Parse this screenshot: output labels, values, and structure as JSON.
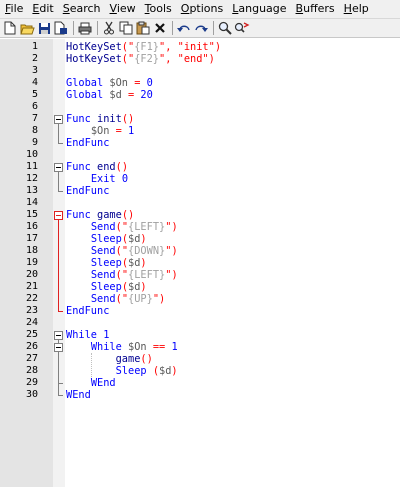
{
  "menu": [
    {
      "label": "File",
      "acc": "F",
      "rest": "ile"
    },
    {
      "label": "Edit",
      "acc": "E",
      "rest": "dit"
    },
    {
      "label": "Search",
      "acc": "S",
      "rest": "earch"
    },
    {
      "label": "View",
      "acc": "V",
      "rest": "iew"
    },
    {
      "label": "Tools",
      "acc": "T",
      "rest": "ools"
    },
    {
      "label": "Options",
      "acc": "O",
      "rest": "ptions"
    },
    {
      "label": "Language",
      "acc": "L",
      "rest": "anguage"
    },
    {
      "label": "Buffers",
      "acc": "B",
      "rest": "uffers"
    },
    {
      "label": "Help",
      "acc": "H",
      "rest": "elp"
    }
  ],
  "toolbar": [
    "new-file-icon",
    "open-folder-icon",
    "save-icon",
    "save-as-icon",
    "print-icon",
    "cut-icon",
    "copy-icon",
    "paste-icon",
    "delete-icon",
    "undo-icon",
    "redo-icon",
    "find-icon",
    "replace-icon"
  ],
  "lines": [
    {
      "n": "1",
      "tokens": [
        [
          "f",
          "HotKeySet"
        ],
        [
          "p",
          "("
        ],
        [
          "s",
          "\""
        ],
        [
          "g",
          "{F1}"
        ],
        [
          "s",
          "\""
        ],
        [
          "p",
          ","
        ],
        [
          "x",
          " "
        ],
        [
          "s",
          "\"init\""
        ],
        [
          "p",
          ")"
        ]
      ]
    },
    {
      "n": "2",
      "tokens": [
        [
          "f",
          "HotKeySet"
        ],
        [
          "p",
          "("
        ],
        [
          "s",
          "\""
        ],
        [
          "g",
          "{F2}"
        ],
        [
          "s",
          "\""
        ],
        [
          "p",
          ","
        ],
        [
          "x",
          " "
        ],
        [
          "s",
          "\"end\""
        ],
        [
          "p",
          ")"
        ]
      ]
    },
    {
      "n": "3",
      "tokens": []
    },
    {
      "n": "4",
      "tokens": [
        [
          "b",
          "Global"
        ],
        [
          "x",
          " "
        ],
        [
          "v",
          "$On"
        ],
        [
          "x",
          " "
        ],
        [
          "p",
          "="
        ],
        [
          "x",
          " "
        ],
        [
          "b",
          "0"
        ]
      ]
    },
    {
      "n": "5",
      "tokens": [
        [
          "b",
          "Global"
        ],
        [
          "x",
          " "
        ],
        [
          "v",
          "$d"
        ],
        [
          "x",
          " "
        ],
        [
          "p",
          "="
        ],
        [
          "x",
          " "
        ],
        [
          "b",
          "20"
        ]
      ]
    },
    {
      "n": "6",
      "tokens": []
    },
    {
      "n": "7",
      "tokens": [
        [
          "b",
          "Func"
        ],
        [
          "x",
          " "
        ],
        [
          "f",
          "init"
        ],
        [
          "p",
          "()"
        ]
      ]
    },
    {
      "n": "8",
      "tokens": [
        [
          "x",
          "    "
        ],
        [
          "v",
          "$On"
        ],
        [
          "x",
          " "
        ],
        [
          "p",
          "="
        ],
        [
          "x",
          " "
        ],
        [
          "b",
          "1"
        ]
      ]
    },
    {
      "n": "9",
      "tokens": [
        [
          "b",
          "EndFunc"
        ]
      ]
    },
    {
      "n": "10",
      "tokens": []
    },
    {
      "n": "11",
      "tokens": [
        [
          "b",
          "Func"
        ],
        [
          "x",
          " "
        ],
        [
          "f",
          "end"
        ],
        [
          "p",
          "()"
        ]
      ]
    },
    {
      "n": "12",
      "tokens": [
        [
          "x",
          "    "
        ],
        [
          "b",
          "Exit"
        ],
        [
          "x",
          " "
        ],
        [
          "b",
          "0"
        ]
      ]
    },
    {
      "n": "13",
      "tokens": [
        [
          "b",
          "EndFunc"
        ]
      ]
    },
    {
      "n": "14",
      "tokens": []
    },
    {
      "n": "15",
      "tokens": [
        [
          "b",
          "Func"
        ],
        [
          "x",
          " "
        ],
        [
          "f",
          "game"
        ],
        [
          "p",
          "()"
        ]
      ]
    },
    {
      "n": "16",
      "tokens": [
        [
          "x",
          "    "
        ],
        [
          "b",
          "Send"
        ],
        [
          "p",
          "("
        ],
        [
          "s",
          "\""
        ],
        [
          "g",
          "{LEFT}"
        ],
        [
          "s",
          "\""
        ],
        [
          "p",
          ")"
        ]
      ]
    },
    {
      "n": "17",
      "tokens": [
        [
          "x",
          "    "
        ],
        [
          "b",
          "Sleep"
        ],
        [
          "p",
          "("
        ],
        [
          "v",
          "$d"
        ],
        [
          "p",
          ")"
        ]
      ]
    },
    {
      "n": "18",
      "tokens": [
        [
          "x",
          "    "
        ],
        [
          "b",
          "Send"
        ],
        [
          "p",
          "("
        ],
        [
          "s",
          "\""
        ],
        [
          "g",
          "{DOWN}"
        ],
        [
          "s",
          "\""
        ],
        [
          "p",
          ")"
        ]
      ]
    },
    {
      "n": "19",
      "tokens": [
        [
          "x",
          "    "
        ],
        [
          "b",
          "Sleep"
        ],
        [
          "p",
          "("
        ],
        [
          "v",
          "$d"
        ],
        [
          "p",
          ")"
        ]
      ]
    },
    {
      "n": "20",
      "tokens": [
        [
          "x",
          "    "
        ],
        [
          "b",
          "Send"
        ],
        [
          "p",
          "("
        ],
        [
          "s",
          "\""
        ],
        [
          "g",
          "{LEFT}"
        ],
        [
          "s",
          "\""
        ],
        [
          "p",
          ")"
        ]
      ]
    },
    {
      "n": "21",
      "tokens": [
        [
          "x",
          "    "
        ],
        [
          "b",
          "Sleep"
        ],
        [
          "p",
          "("
        ],
        [
          "v",
          "$d"
        ],
        [
          "p",
          ")"
        ]
      ]
    },
    {
      "n": "22",
      "tokens": [
        [
          "x",
          "    "
        ],
        [
          "b",
          "Send"
        ],
        [
          "p",
          "("
        ],
        [
          "s",
          "\""
        ],
        [
          "g",
          "{UP}"
        ],
        [
          "s",
          "\""
        ],
        [
          "p",
          ")"
        ]
      ]
    },
    {
      "n": "23",
      "tokens": [
        [
          "b",
          "EndFunc"
        ]
      ]
    },
    {
      "n": "24",
      "tokens": []
    },
    {
      "n": "25",
      "tokens": [
        [
          "b",
          "While"
        ],
        [
          "x",
          " "
        ],
        [
          "b",
          "1"
        ]
      ]
    },
    {
      "n": "26",
      "tokens": [
        [
          "x",
          "    "
        ],
        [
          "b",
          "While"
        ],
        [
          "x",
          " "
        ],
        [
          "v",
          "$On"
        ],
        [
          "x",
          " "
        ],
        [
          "p",
          "=="
        ],
        [
          "x",
          " "
        ],
        [
          "b",
          "1"
        ]
      ]
    },
    {
      "n": "27",
      "tokens": [
        [
          "x",
          "        "
        ],
        [
          "f",
          "game"
        ],
        [
          "p",
          "()"
        ]
      ]
    },
    {
      "n": "28",
      "tokens": [
        [
          "x",
          "        "
        ],
        [
          "b",
          "Sleep"
        ],
        [
          "x",
          " "
        ],
        [
          "p",
          "("
        ],
        [
          "v",
          "$d"
        ],
        [
          "p",
          ")"
        ]
      ]
    },
    {
      "n": "29",
      "tokens": [
        [
          "x",
          "    "
        ],
        [
          "b",
          "WEnd"
        ]
      ]
    },
    {
      "n": "30",
      "tokens": [
        [
          "b",
          "WEnd"
        ]
      ]
    }
  ],
  "colors": {
    "keyword": "#0000ff",
    "operator": "#ff0000",
    "string": "#ff0000",
    "macro": "#a0a0a0",
    "function": "#000090",
    "variable": "#5a5a5a"
  }
}
